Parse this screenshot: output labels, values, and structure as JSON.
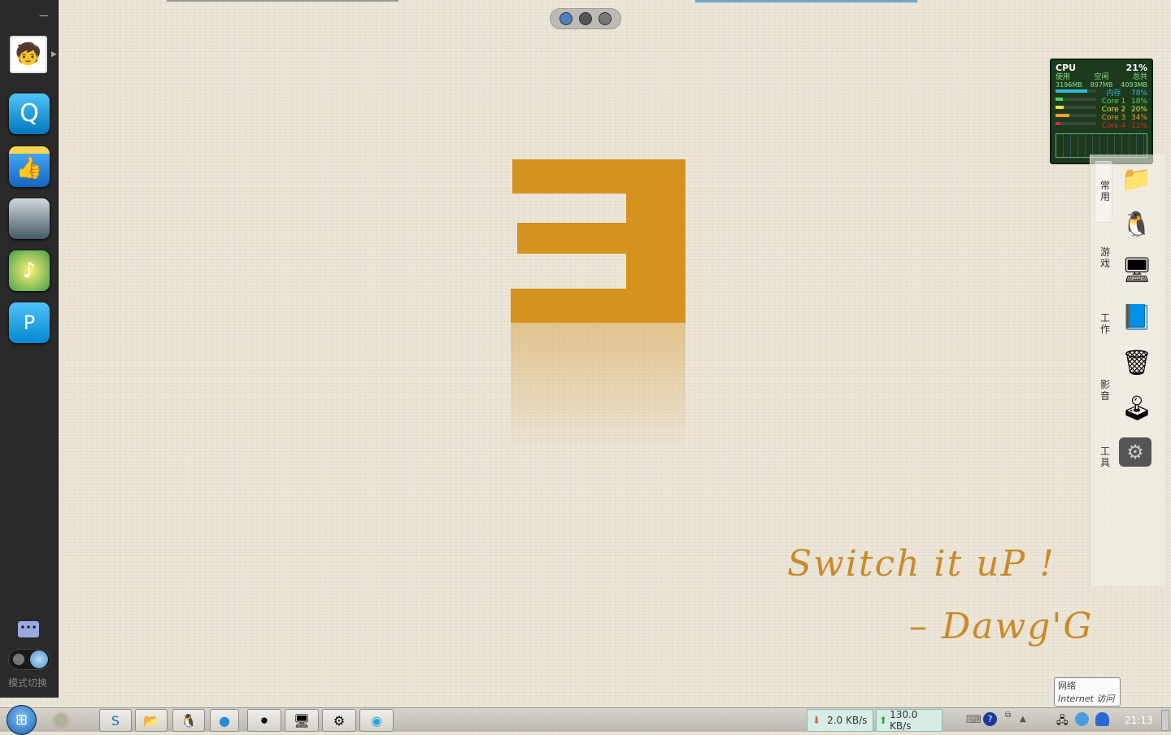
{
  "sidebar": {
    "minimize": "—",
    "mode_label": "模式切换",
    "icons": [
      "qq-search",
      "thumbs-up-app",
      "anime-avatar-app",
      "music-app",
      "qq-map-app"
    ]
  },
  "cpu": {
    "title": "CPU",
    "total_percent": "21%",
    "headers": [
      "使用",
      "空闲",
      "总共"
    ],
    "values": [
      "3196MB",
      "897MB",
      "4093MB"
    ],
    "rows": [
      {
        "label": "内存",
        "value": "78%",
        "color": "#35b8d8",
        "fill": 78
      },
      {
        "label": "Core 1",
        "value": "18%",
        "color": "#4fd45f",
        "fill": 18
      },
      {
        "label": "Core 2",
        "value": "20%",
        "color": "#e8e050",
        "fill": 20
      },
      {
        "label": "Core 3",
        "value": "34%",
        "color": "#f0a030",
        "fill": 34
      },
      {
        "label": "Core 4",
        "value": "11%",
        "color": "#d03030",
        "fill": 11
      }
    ]
  },
  "dock": {
    "categories": [
      "常用",
      "游戏",
      "工作",
      "影音",
      "工具"
    ]
  },
  "wallpaper": {
    "line1": "Switch it uP !",
    "line2": "– Dawg'G",
    "accent": "#d4921f"
  },
  "taskbar": {
    "download": "2.0 KB/s",
    "upload": "130.0 KB/s",
    "clock": "21:13"
  },
  "tooltip": {
    "title": "网络",
    "subtitle": "Internet 访问"
  }
}
